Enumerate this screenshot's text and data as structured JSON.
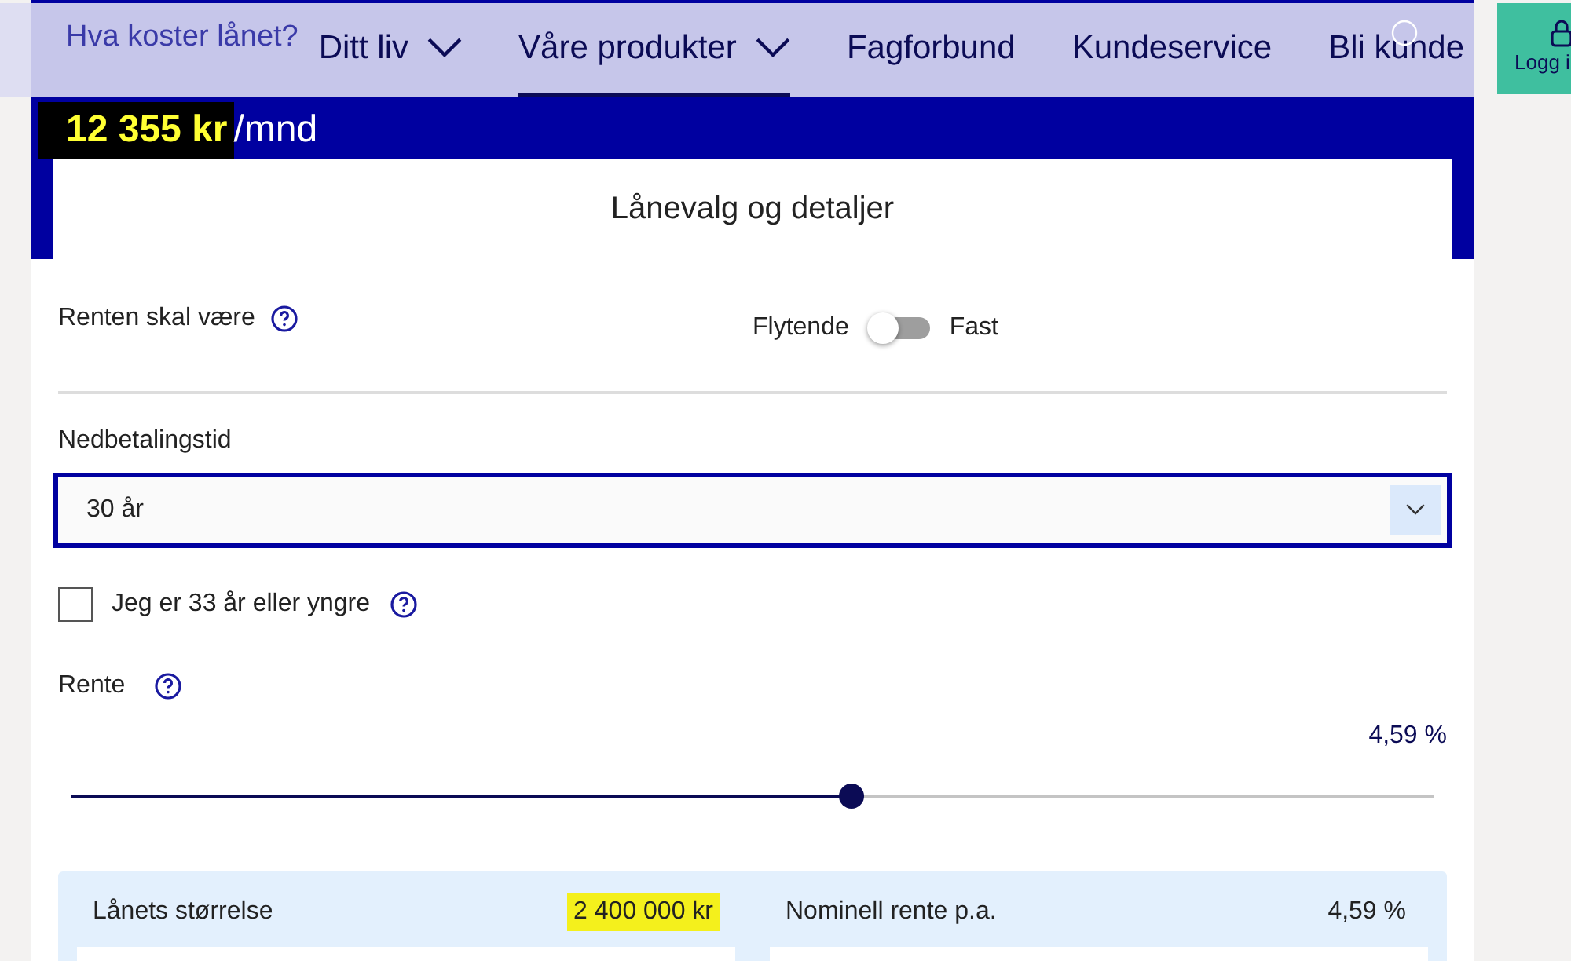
{
  "nav": {
    "items": [
      {
        "label": "Ditt liv",
        "dropdown": true,
        "selected": false
      },
      {
        "label": "Våre produkter",
        "dropdown": true,
        "selected": true
      },
      {
        "label": "Fagforbund",
        "dropdown": false,
        "selected": false
      },
      {
        "label": "Kundeservice",
        "dropdown": false,
        "selected": false
      },
      {
        "label": "Bli kunde",
        "dropdown": false,
        "selected": false
      }
    ],
    "login": "Logg i"
  },
  "header": {
    "title": "Hva koster lånet?",
    "amount": "12 355 kr",
    "unit": "/mnd",
    "highlighted": true
  },
  "card_title": "Lånevalg og detaljer",
  "rate_type": {
    "label": "Renten skal være",
    "left": "Flytende",
    "right": "Fast",
    "on": false
  },
  "term": {
    "label": "Nedbetalingstid",
    "value": "30 år"
  },
  "young": {
    "label": "Jeg er 33 år eller yngre",
    "checked": false
  },
  "rate": {
    "label": "Rente",
    "reading": "4,59 %",
    "level": 0.573
  },
  "summary": [
    {
      "label": "Lånets størrelse",
      "value": "2 400 000 kr",
      "highlighted": true
    },
    {
      "label": "Nominell rente p.a.",
      "value": "4,59 %",
      "highlighted": false
    }
  ]
}
